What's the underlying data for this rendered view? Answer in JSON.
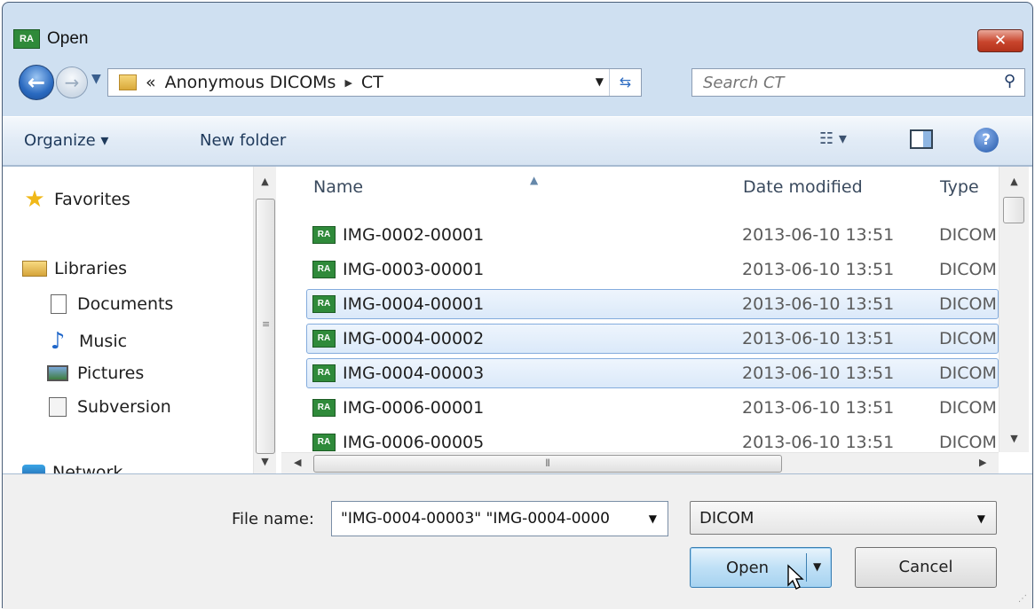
{
  "window": {
    "title": "Open",
    "app_icon": "RA",
    "close_label": "✕"
  },
  "nav": {
    "address": [
      "«",
      "Anonymous DICOMs",
      "CT"
    ],
    "search_placeholder": "Search CT"
  },
  "toolbar": {
    "organize": "Organize ▾",
    "new_folder": "New folder",
    "views": "☷ ▾",
    "help": "?"
  },
  "sidebar": {
    "favorites": "Favorites",
    "libraries": "Libraries",
    "items": [
      "Documents",
      "Music",
      "Pictures",
      "Subversion"
    ],
    "network": "Network"
  },
  "columns": {
    "name": "Name",
    "date": "Date modified",
    "type": "Type"
  },
  "files": [
    {
      "name": "IMG-0002-00001",
      "date": "2013-06-10 13:51",
      "type": "DICOM",
      "selected": false
    },
    {
      "name": "IMG-0003-00001",
      "date": "2013-06-10 13:51",
      "type": "DICOM",
      "selected": false
    },
    {
      "name": "IMG-0004-00001",
      "date": "2013-06-10 13:51",
      "type": "DICOM",
      "selected": true
    },
    {
      "name": "IMG-0004-00002",
      "date": "2013-06-10 13:51",
      "type": "DICOM",
      "selected": true
    },
    {
      "name": "IMG-0004-00003",
      "date": "2013-06-10 13:51",
      "type": "DICOM",
      "selected": true
    },
    {
      "name": "IMG-0006-00001",
      "date": "2013-06-10 13:51",
      "type": "DICOM",
      "selected": false
    },
    {
      "name": "IMG-0006-00005",
      "date": "2013-06-10 13:51",
      "type": "DICOM",
      "selected": false
    }
  ],
  "bottom": {
    "file_name_label": "File name:",
    "file_name_value": "\"IMG-0004-00003\" \"IMG-0004-0000",
    "file_type": "DICOM",
    "open": "Open",
    "cancel": "Cancel"
  },
  "colors": {
    "accent": "#3c7fb1",
    "selection": "#dbe9f9",
    "icon_green": "#2f8a3a"
  }
}
